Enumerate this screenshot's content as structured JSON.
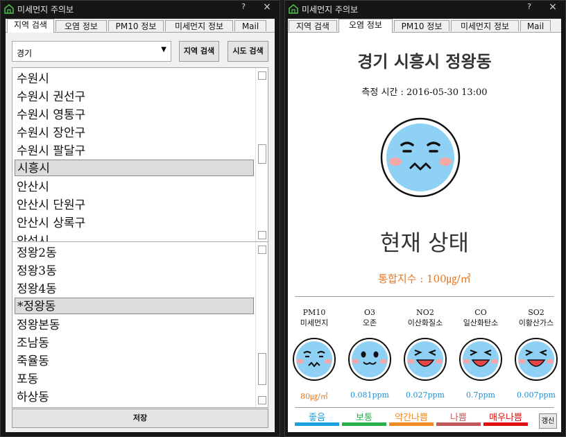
{
  "app": {
    "title": "미세먼지 주의보",
    "help": "?",
    "close": "×"
  },
  "tabs": [
    "지역 검색",
    "오염 정보",
    "PM10 정보",
    "미세먼지 정보",
    "Mail"
  ],
  "search": {
    "region_value": "경기",
    "region_search_label": "지역 검색",
    "city_search_label": "시도 검색",
    "cities": [
      "수원시",
      "수원시 권선구",
      "수원시 영통구",
      "수원시 장안구",
      "수원시 팔달구",
      "시흥시",
      "안산시",
      "안산시 단원구",
      "안산시 상록구",
      "안성시"
    ],
    "selected_city": "시흥시",
    "dongs": [
      "정왕2동",
      "정왕3동",
      "정왕4동",
      "*정왕동",
      "정왕본동",
      "조남동",
      "죽율동",
      "포동",
      "하상동"
    ],
    "selected_dong": "*정왕동",
    "save_label": "저장"
  },
  "info": {
    "location": "경기 시흥시 정왕동",
    "measure_time": "측정 시간 : 2016-05-30 13:00",
    "status_title": "현재 상태",
    "index_text": "통합지수 : 100㎍/㎥",
    "pollutants": [
      {
        "code": "PM10",
        "name": "미세먼지",
        "value": "80㎍/㎥",
        "mood": "moderate",
        "value_color": "#e87722"
      },
      {
        "code": "O3",
        "name": "오존",
        "value": "0.081ppm",
        "mood": "good-calm",
        "value_color": "#1a8fd0"
      },
      {
        "code": "NO2",
        "name": "이산화질소",
        "value": "0.027ppm",
        "mood": "good-happy",
        "value_color": "#1a8fd0"
      },
      {
        "code": "CO",
        "name": "일산화탄소",
        "value": "0.7ppm",
        "mood": "good-happy",
        "value_color": "#1a8fd0"
      },
      {
        "code": "SO2",
        "name": "이황산가스",
        "value": "0.007ppm",
        "mood": "good-happy",
        "value_color": "#1a8fd0"
      }
    ],
    "legend": [
      {
        "label": "좋음",
        "color": "#1a9fe0"
      },
      {
        "label": "보통",
        "color": "#27b04a"
      },
      {
        "label": "약간나쁨",
        "color": "#f08a24"
      },
      {
        "label": "나쁨",
        "color": "#c05a5a"
      },
      {
        "label": "매우나쁨",
        "color": "#e01010"
      }
    ],
    "refresh_label": "갱신"
  },
  "colors": {
    "face_fill": "#8fd1f5",
    "cheek": "#f4a7a7"
  }
}
